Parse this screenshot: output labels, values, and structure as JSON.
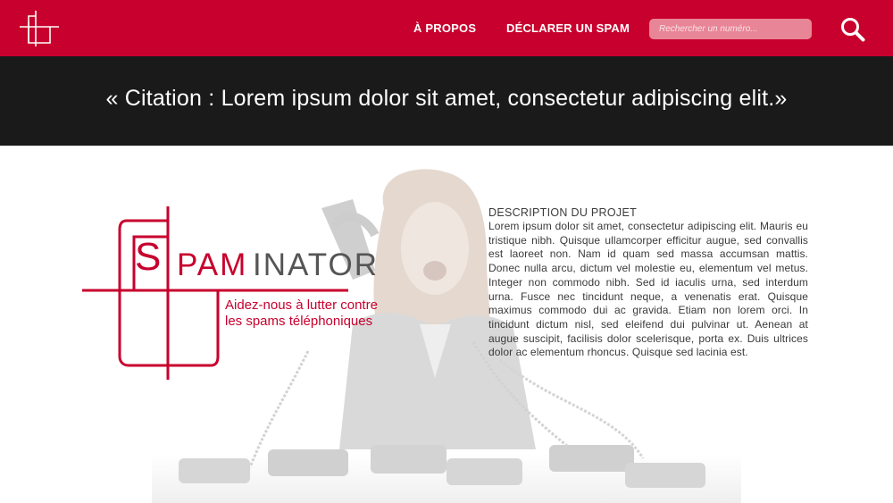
{
  "header": {
    "logo_name": "site-logo",
    "nav": [
      {
        "label": "À PROPOS"
      },
      {
        "label": "DÉCLARER UN SPAM"
      }
    ],
    "search": {
      "placeholder": "Rechercher un numéro...",
      "value": ""
    },
    "search_icon": "search-icon",
    "bg_color": "#c8002d"
  },
  "quote": {
    "text": "« Citation : Lorem ipsum dolor sit amet, consectetur adipiscing elit.»",
    "bg_color": "#1a1a1a"
  },
  "hero": {
    "brand": {
      "s": "S",
      "pam": "PAM",
      "inator": "INATOR"
    },
    "tagline": [
      "Aidez-nous à lutter contre",
      "les spams téléphoniques"
    ],
    "description": {
      "title": "DESCRIPTION DU PROJET",
      "body": "Lorem ipsum dolor sit amet, consectetur adipiscing elit. Mauris eu tristique nibh. Quisque ullamcorper efficitur augue, sed convallis est laoreet non. Nam id quam sed massa accumsan mattis. Donec nulla arcu, dictum vel molestie eu, elementum vel metus. Integer non commodo nibh. Sed id iaculis urna, sed interdum urna. Fusce nec tincidunt neque, a venenatis erat. Quisque maximus commodo dui ac gravida. Etiam non lorem orci. In tincidunt dictum nisl, sed eleifend dui pulvinar ut. Aenean at augue suscipit, facilisis dolor scelerisque, porta ex. Duis ultrices dolor ac elementum rhoncus. Quisque sed lacinia est."
    },
    "accent_color": "#c8002d"
  }
}
